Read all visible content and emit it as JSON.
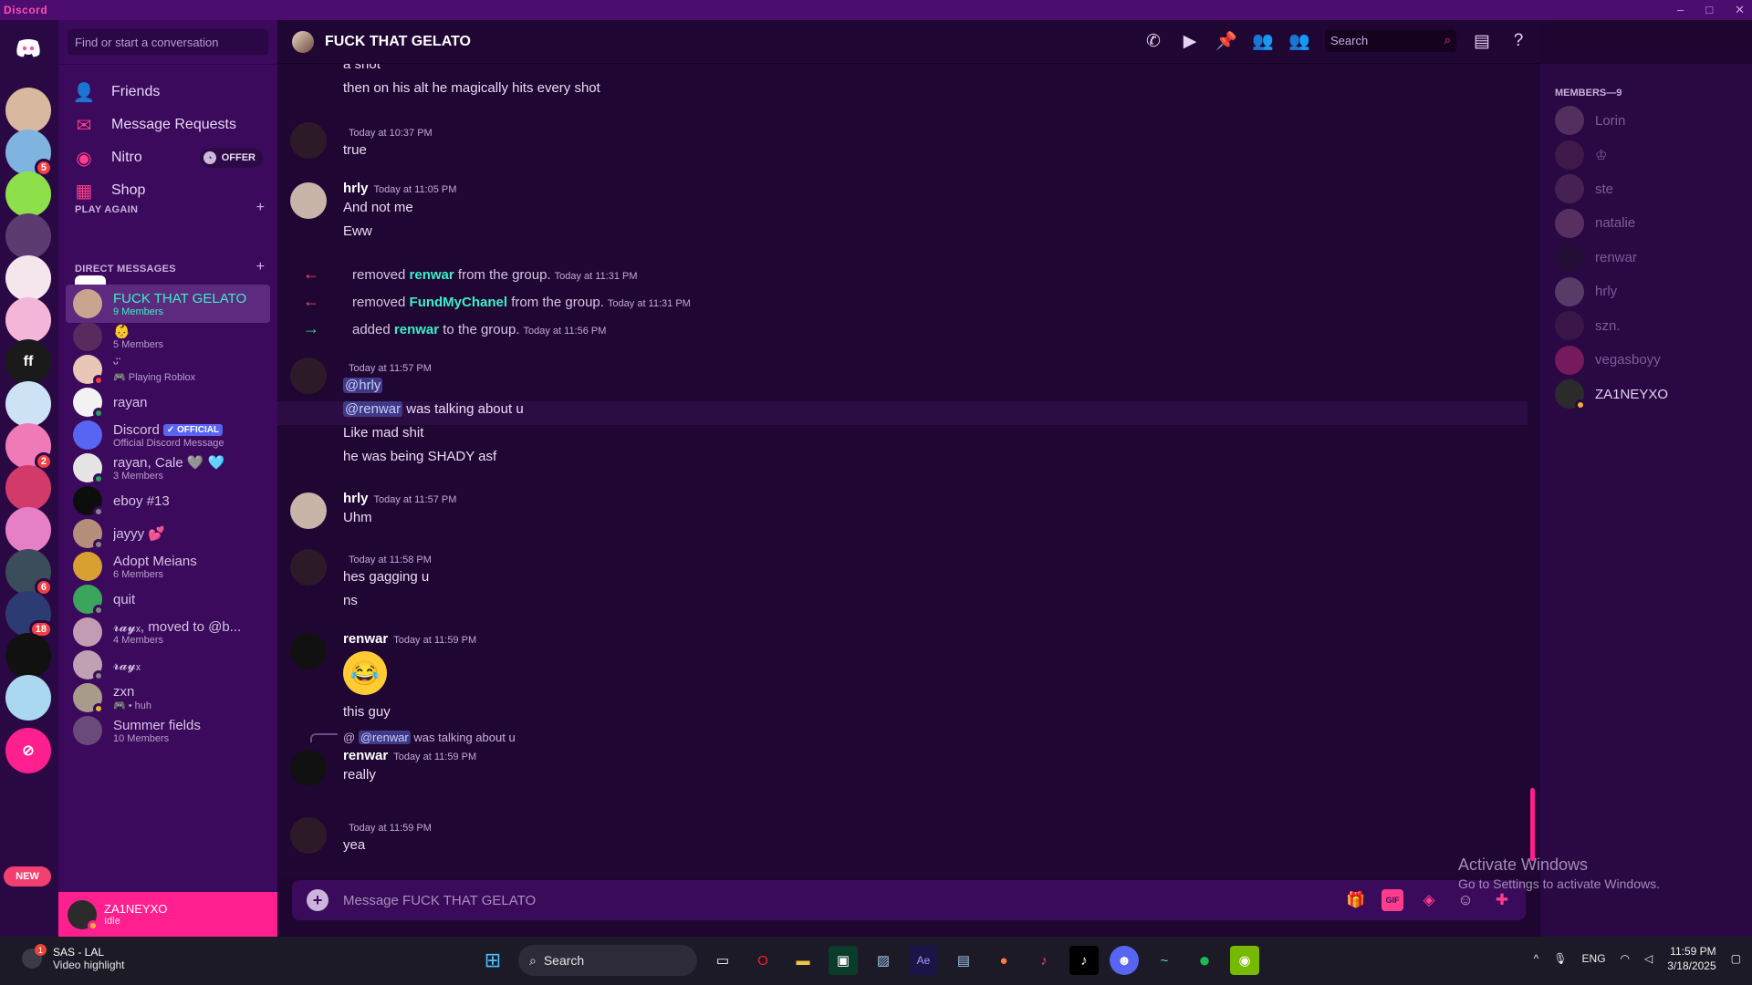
{
  "app": {
    "brand": "Discord"
  },
  "window_controls": [
    "–",
    "□",
    "✕"
  ],
  "servers": [
    {
      "label": "",
      "color": "#ff4fb3",
      "badge": ""
    },
    {
      "label": "",
      "color": "#d9b8a0",
      "badge": ""
    },
    {
      "label": "",
      "color": "#7fb4e0",
      "badge": "5"
    },
    {
      "label": "",
      "color": "#8de04a",
      "badge": ""
    },
    {
      "label": "",
      "color": "#5c3c70",
      "badge": ""
    },
    {
      "label": "",
      "color": "#f5e6ee",
      "badge": ""
    },
    {
      "label": "",
      "color": "#f4b6d8",
      "badge": ""
    },
    {
      "label": "ff",
      "color": "#1a1a1a",
      "badge": ""
    },
    {
      "label": "",
      "color": "#cde2f5",
      "badge": ""
    },
    {
      "label": "",
      "color": "#f07ab8",
      "badge": "2"
    },
    {
      "label": "",
      "color": "#d23a6a",
      "badge": ""
    },
    {
      "label": "",
      "color": "#e67fc5",
      "badge": ""
    },
    {
      "label": "",
      "color": "#3b4d5a",
      "badge": "6"
    },
    {
      "label": "",
      "color": "#2c3b72",
      "badge": "18"
    },
    {
      "label": "",
      "color": "#111111",
      "badge": ""
    },
    {
      "label": "",
      "color": "#a9d8f0",
      "badge": ""
    }
  ],
  "new_tag": "NEW",
  "sidebar": {
    "search_placeholder": "Find or start a conversation",
    "nav": [
      {
        "label": "Friends",
        "icon": "👤"
      },
      {
        "label": "Message Requests",
        "icon": "✉"
      },
      {
        "label": "Nitro",
        "icon": "◉"
      },
      {
        "label": "Shop",
        "icon": "▦"
      }
    ],
    "offer_label": "OFFER",
    "play_again": "PLAY AGAIN",
    "direct_messages": "DIRECT MESSAGES",
    "dms": [
      {
        "name": "FUCK THAT GELATO",
        "sub": "9 Members",
        "color": "#c9a48f",
        "status": "",
        "active": true
      },
      {
        "name": "👶",
        "sub": "5 Members",
        "color": "#5a2a5f",
        "status": "",
        "active": false
      },
      {
        "name": "ᵕ̈",
        "sub": "🎮 Playing Roblox",
        "color": "#e9c6b5",
        "status": "#f23f43",
        "active": false
      },
      {
        "name": "rayan",
        "sub": "",
        "color": "#f2f2f2",
        "status": "#23a55a",
        "active": false
      },
      {
        "name": "Discord",
        "sub": "Official Discord Message",
        "color": "#5865f2",
        "status": "",
        "active": false,
        "official": "✓ OFFICIAL"
      },
      {
        "name": "rayan, Cale 🩶 🩵",
        "sub": "3 Members",
        "color": "#e5e5e5",
        "status": "#23a55a",
        "active": false
      },
      {
        "name": "eboy #13",
        "sub": "",
        "color": "#0d0d0d",
        "status": "#80848e",
        "active": false
      },
      {
        "name": "jayyy 💕",
        "sub": "",
        "color": "#b58f7a",
        "status": "#80848e",
        "active": false
      },
      {
        "name": "Adopt Meians",
        "sub": "6 Members",
        "color": "#d8a030",
        "status": "",
        "active": false
      },
      {
        "name": "quit",
        "sub": "",
        "color": "#3ba55c",
        "status": "#80848e",
        "active": false
      },
      {
        "name": "𝓻𝓪𝔂ₓ, moved to @b...",
        "sub": "4 Members",
        "color": "#c29cb2",
        "status": "",
        "active": false
      },
      {
        "name": "𝓻𝓪𝔂ₓ",
        "sub": "",
        "color": "#bfa1b3",
        "status": "#80848e",
        "active": false
      },
      {
        "name": "zxn",
        "sub": "🎮 • huh",
        "color": "#a89b8a",
        "status": "#f0b232",
        "active": false
      },
      {
        "name": "Summer fields",
        "sub": "10 Members",
        "color": "#6a4a7a",
        "status": "",
        "active": false
      }
    ]
  },
  "user": {
    "name": "ZA1NEYXO",
    "status": "Idle"
  },
  "channel": {
    "title": "FUCK THAT GELATO",
    "search_placeholder": "Search"
  },
  "header_icons": [
    "phone-icon",
    "video-icon",
    "pin-icon",
    "add-member-icon",
    "members-icon",
    "inbox-icon",
    "help-icon"
  ],
  "messages": {
    "top_line1": "a shot",
    "top_line2": "then on his alt he magically hits every shot",
    "m1": {
      "time": "Today at 10:37 PM",
      "line": "true"
    },
    "m2": {
      "author": "hrly",
      "time": "Today at 11:05 PM",
      "l1": "And not me",
      "l2": "Eww"
    },
    "sys": [
      {
        "pre": "removed",
        "who": "renwar",
        "post": "from the group.",
        "time": "Today at 11:31 PM",
        "arrow": "←",
        "color": "#ff4d6a"
      },
      {
        "pre": "removed",
        "who": "FundMyChanel",
        "post": "from the group.",
        "time": "Today at 11:31 PM",
        "arrow": "←",
        "color": "#ff4d6a"
      },
      {
        "pre": "added",
        "who": "renwar",
        "post": "to the group.",
        "time": "Today at 11:56 PM",
        "arrow": "→",
        "color": "#3ad38a"
      }
    ],
    "m3": {
      "time": "Today at 11:57 PM",
      "mention1": "@hrly",
      "mention2": "@renwar",
      "l2": "was talking about u",
      "l3": "Like mad shit",
      "l4": "he was being SHADY asf"
    },
    "m4": {
      "author": "hrly",
      "time": "Today at 11:57 PM",
      "line": "Uhm"
    },
    "m5": {
      "time": "Today at 11:58 PM",
      "l1": "hes gagging u",
      "l2": "ns"
    },
    "m6": {
      "author": "renwar",
      "time": "Today at 11:59 PM",
      "emoji": "😂",
      "line": "this guy"
    },
    "m7": {
      "reply_at": "@",
      "reply_mention": "@renwar",
      "reply_text": "was talking about u",
      "author": "renwar",
      "time": "Today at 11:59 PM",
      "line": "really"
    },
    "m8": {
      "time": "Today at 11:59 PM",
      "line": "yea"
    }
  },
  "composer": {
    "placeholder": "Message FUCK THAT GELATO",
    "gif": "GIF"
  },
  "members": {
    "header": "MEMBERS—9",
    "list": [
      {
        "name": "Lorin",
        "color": "#a07890",
        "online": false
      },
      {
        "name": "♔",
        "color": "#6a3a5a",
        "online": false
      },
      {
        "name": "ste",
        "color": "#7a5070",
        "online": false
      },
      {
        "name": "natalie",
        "color": "#b07a95",
        "online": false
      },
      {
        "name": "renwar",
        "color": "#1a1a1a",
        "online": false
      },
      {
        "name": "hrly",
        "color": "#b09aa8",
        "online": false
      },
      {
        "name": "szn.",
        "color": "#5a3050",
        "online": false
      },
      {
        "name": "vegasboyy",
        "color": "#ff3d8b",
        "online": false
      },
      {
        "name": "ZA1NEYXO",
        "color": "#2b2b2b",
        "online": true
      }
    ]
  },
  "watermark": {
    "line1": "Activate Windows",
    "line2": "Go to Settings to activate Windows."
  },
  "taskbar": {
    "widget_title": "SAS - LAL",
    "widget_sub": "Video highlight",
    "search": "Search",
    "lang": "ENG",
    "time": "11:59 PM",
    "date": "3/18/2025"
  }
}
